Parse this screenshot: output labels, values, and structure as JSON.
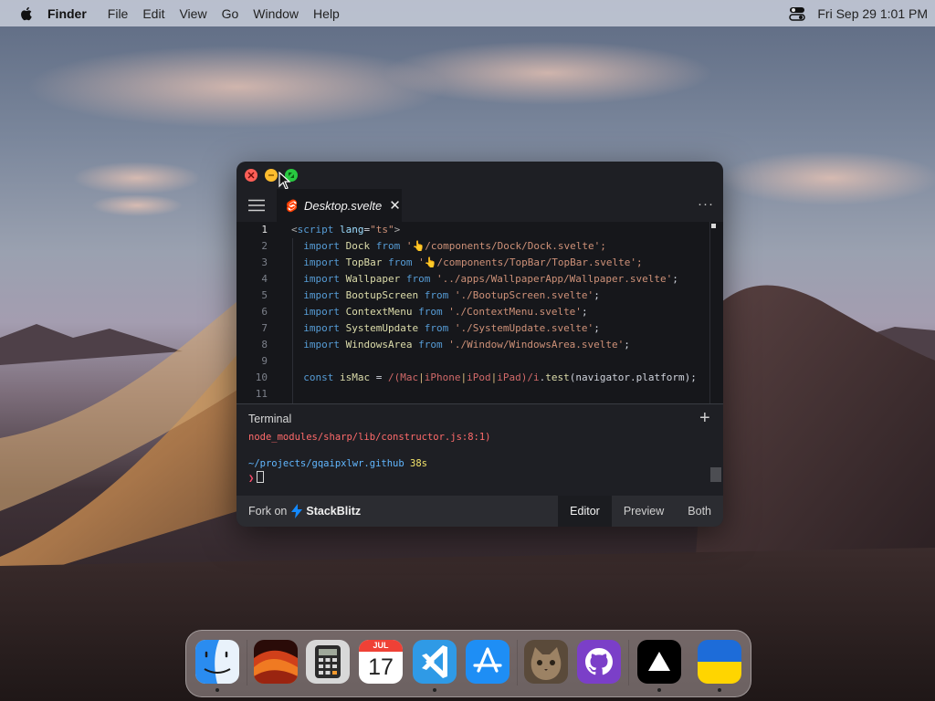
{
  "menubar": {
    "app_name": "Finder",
    "menus": [
      "File",
      "Edit",
      "View",
      "Go",
      "Window",
      "Help"
    ],
    "clock": "Fri Sep 29  1:01 PM"
  },
  "window": {
    "tab": {
      "label": "Desktop.svelte",
      "close": "✕"
    },
    "more": "···",
    "line_numbers": [
      "1",
      "2",
      "3",
      "4",
      "5",
      "6",
      "7",
      "8",
      "9",
      "10",
      "11"
    ],
    "code": {
      "l1": {
        "open": "<",
        "tag": "script",
        "attr": " lang",
        "eq": "=",
        "val": "\"ts\"",
        "close": ">"
      },
      "l2": {
        "kw": "import",
        "id": "Dock",
        "from": "from",
        "q": "'",
        "hand": "👆",
        "path": "/components/Dock/Dock.svelte",
        "end": "';"
      },
      "l3": {
        "kw": "import",
        "id": "TopBar",
        "from": "from",
        "q": "'",
        "hand": "👆",
        "path": "/components/TopBar/TopBar.svelte",
        "end": "';"
      },
      "l4": {
        "kw": "import",
        "id": "Wallpaper",
        "from": "from",
        "str": "'../apps/WallpaperApp/Wallpaper.svelte'",
        "end": ";"
      },
      "l5": {
        "kw": "import",
        "id": "BootupScreen",
        "from": "from",
        "str": "'./BootupScreen.svelte'",
        "end": ";"
      },
      "l6": {
        "kw": "import",
        "id": "ContextMenu",
        "from": "from",
        "str": "'./ContextMenu.svelte'",
        "end": ";"
      },
      "l7": {
        "kw": "import",
        "id": "SystemUpdate",
        "from": "from",
        "str": "'./SystemUpdate.svelte'",
        "end": ";"
      },
      "l8": {
        "kw": "import",
        "id": "WindowsArea",
        "from": "from",
        "str": "'./Window/WindowsArea.svelte'",
        "end": ";"
      },
      "l10": {
        "kw": "const",
        "id": "isMac",
        "eq": " = ",
        "rx_open": "/(",
        "a1": "Mac",
        "p1": "|",
        "a2": "iPhone",
        "p2": "|",
        "a3": "iPod",
        "p3": "|",
        "a4": "iPad",
        "rx_close": ")/",
        "flag": "i",
        "dot": ".",
        "fn": "test",
        "args": "(navigator.platform);"
      }
    },
    "terminal": {
      "title": "Terminal",
      "plus": "+",
      "error": "node_modules/sharp/lib/constructor.js:8:1)",
      "path": "~/projects/gqaipxlwr.github",
      "duration": "38s",
      "prompt": "❯"
    },
    "footer": {
      "fork": "Fork on",
      "brand": "StackBlitz",
      "views": [
        "Editor",
        "Preview",
        "Both"
      ],
      "active_view": "Editor"
    }
  },
  "dock": {
    "calendar": {
      "month": "JUL",
      "day": "17"
    }
  }
}
